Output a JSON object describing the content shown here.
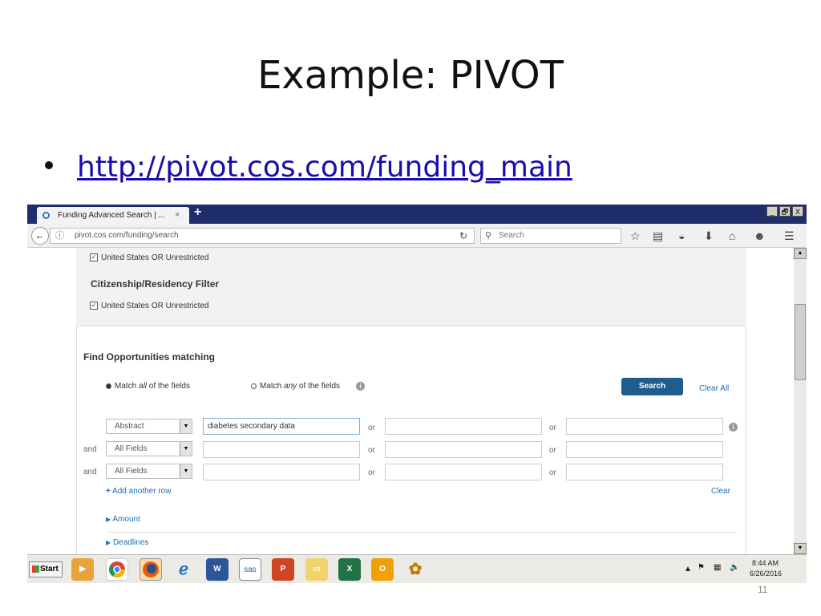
{
  "slide": {
    "title": "Example:  PIVOT",
    "link": "http://pivot.cos.com/funding_main",
    "page_number": "11"
  },
  "browser": {
    "tab_title": "Funding Advanced Search | ...",
    "tab_close": "×",
    "new_tab": "+",
    "url": "pivot.cos.com/funding/search",
    "search_placeholder": "Search",
    "window_controls": [
      "_",
      "🗗",
      "X"
    ]
  },
  "page": {
    "location_checkbox": "United States OR Unrestricted",
    "citizenship_heading": "Citizenship/Residency Filter",
    "citizenship_checkbox": "United States OR Unrestricted",
    "find_heading": "Find Opportunities matching",
    "match_all_prefix": "Match ",
    "match_all_em": "all",
    "match_all_suffix": " of the fields",
    "match_any_prefix": "Match ",
    "match_any_em": "any",
    "match_any_suffix": " of the fields",
    "search_button": "Search",
    "clear_all": "Clear All",
    "rows": [
      {
        "prefix": "",
        "field": "Abstract",
        "term1": "diabetes secondary data",
        "or1": "or",
        "or2": "or"
      },
      {
        "prefix": "and",
        "field": "All Fields",
        "term1": "",
        "or1": "or",
        "or2": "or"
      },
      {
        "prefix": "and",
        "field": "All Fields",
        "term1": "",
        "or1": "or",
        "or2": "or"
      }
    ],
    "add_row": "Add another row",
    "clear": "Clear",
    "amount": "Amount",
    "deadlines": "Deadlines"
  },
  "taskbar": {
    "start": "Start",
    "sas": "sas",
    "time": "8:44 AM",
    "date": "6/26/2016"
  }
}
